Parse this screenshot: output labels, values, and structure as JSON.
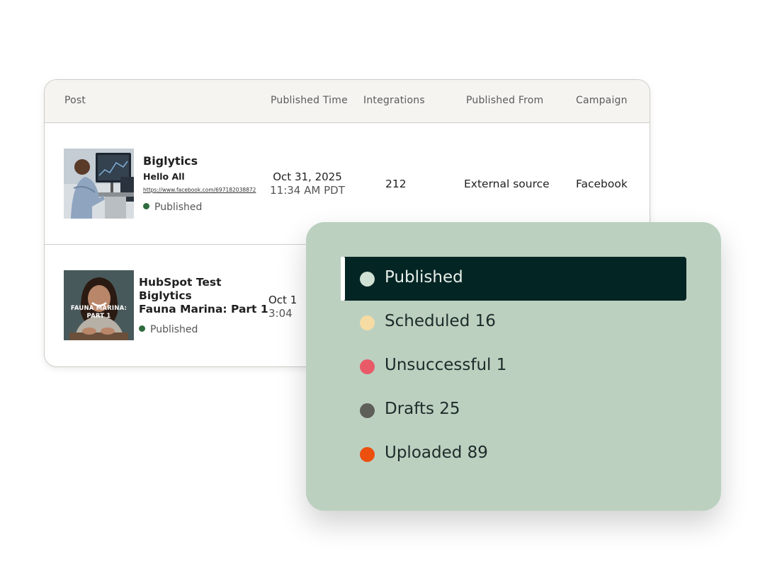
{
  "table": {
    "columns": {
      "post": "Post",
      "published_time": "Published Time",
      "integrations": "Integrations",
      "published_from": "Published From",
      "campaign": "Campaign"
    },
    "rows": [
      {
        "thumbnail": "person-at-computer-image",
        "title": "Biglytics",
        "subtitle": "Hello All",
        "link": "https://www.facebook.com/697182038872",
        "status": "Published",
        "date": "Oct 31, 2025",
        "time": "11:34 AM PDT",
        "integrations": "212",
        "published_from": "External source",
        "campaign": "Facebook"
      },
      {
        "thumbnail": "smiling-woman-video-image",
        "thumbnail_caption": "FAUNA MARINA: PART 1",
        "title_line1": "HubSpot Test",
        "title_line2": "Biglytics",
        "title_line3": "Fauna Marina: Part 1",
        "status": "Published",
        "date": "Oct 1",
        "time": "3:04"
      }
    ]
  },
  "status_filter": {
    "items": [
      {
        "label": "Published",
        "color": "#cfe0d4",
        "active": true
      },
      {
        "label": "Scheduled 16",
        "color": "#f6dba3",
        "active": false
      },
      {
        "label": "Unsuccessful 1",
        "color": "#e95a68",
        "active": false
      },
      {
        "label": "Drafts 25",
        "color": "#5f5f5a",
        "active": false
      },
      {
        "label": "Uploaded 89",
        "color": "#ec4f0e",
        "active": false
      }
    ]
  },
  "colors": {
    "published_dot": "#2e6b3f",
    "panel_background": "#bcd0c0",
    "active_item_background": "#032524"
  }
}
